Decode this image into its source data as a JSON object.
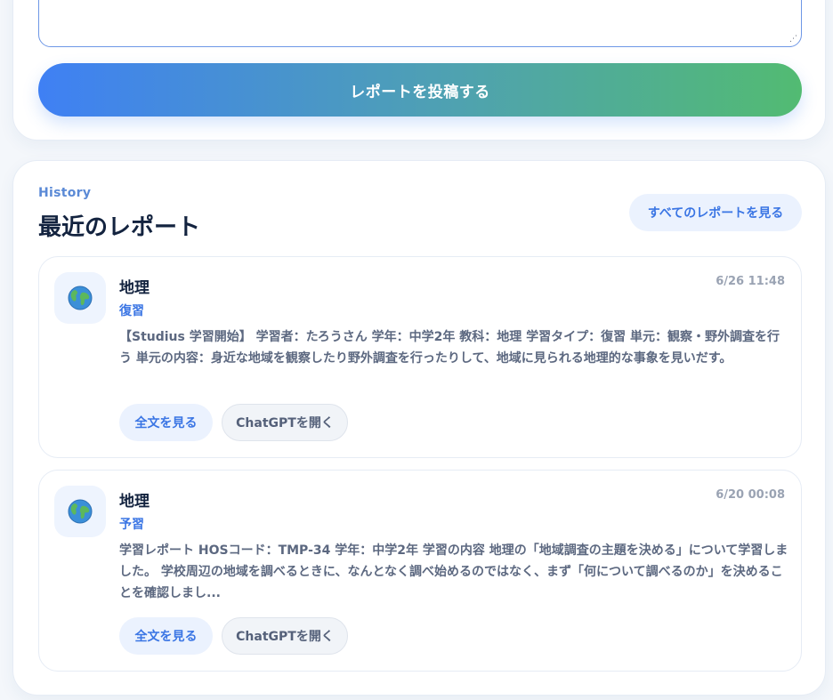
{
  "form": {
    "textarea_value": "",
    "submit_label": "レポートを投稿する"
  },
  "history": {
    "eyebrow": "History",
    "title": "最近のレポート",
    "view_all_label": "すべてのレポートを見る",
    "reports": [
      {
        "icon": "globe-icon",
        "subject": "地理",
        "type": "復習",
        "timestamp": "6/26 11:48",
        "excerpt": "【Studius 学習開始】 学習者：たろうさん 学年：中学2年 教科：地理 学習タイプ：復習 単元：観察・野外調査を行う 単元の内容：身近な地域を観察したり野外調査を行ったりして、地域に見られる地理的な事象を見いだす。",
        "fulltext_label": "全文を見る",
        "chatgpt_label": "ChatGPTを開く"
      },
      {
        "icon": "globe-icon",
        "subject": "地理",
        "type": "予習",
        "timestamp": "6/20 00:08",
        "excerpt": "学習レポート HOSコード：TMP-34 学年：中学2年 学習の内容 地理の「地域調査の主題を決める」について学習しました。 学校周辺の地域を調べるときに、なんとなく調べ始めるのではなく、まず「何について調べるのか」を決めることを確認しまし...",
        "fulltext_label": "全文を見る",
        "chatgpt_label": "ChatGPTを開く"
      }
    ]
  },
  "colors": {
    "accent": "#3a75e4",
    "gradient_start": "#3f80f4",
    "gradient_end": "#52bb72",
    "title": "#13233f",
    "muted": "#9aa3b3"
  }
}
